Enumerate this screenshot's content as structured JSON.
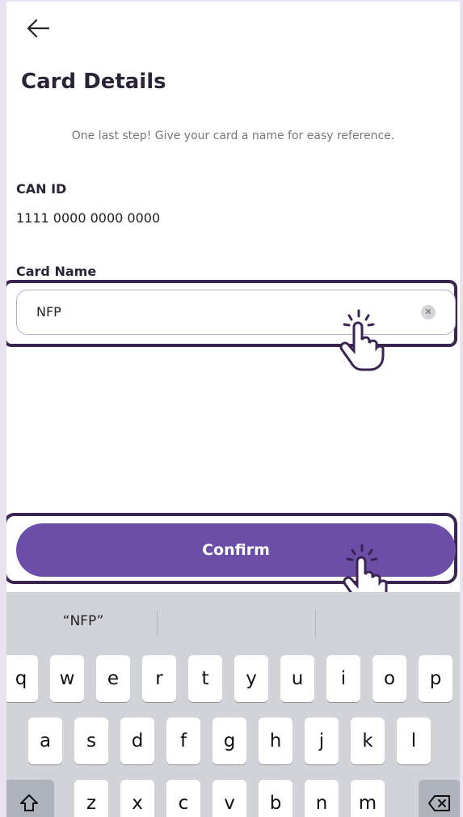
{
  "header": {
    "back_icon": "arrow-left-icon",
    "title": "Card Details"
  },
  "subtitle": "One last step! Give your card a name for easy reference.",
  "can": {
    "label": "CAN ID",
    "value": "1111 0000 0000 0000"
  },
  "card_name": {
    "label": "Card Name",
    "value": "NFP",
    "clear_icon": "clear-x-icon"
  },
  "confirm_label": "Confirm",
  "keyboard": {
    "suggestion": "“NFP”",
    "row1": [
      "q",
      "w",
      "e",
      "r",
      "t",
      "y",
      "u",
      "i",
      "o",
      "p"
    ],
    "row2": [
      "a",
      "s",
      "d",
      "f",
      "g",
      "h",
      "j",
      "k",
      "l"
    ],
    "row3": [
      "z",
      "x",
      "c",
      "v",
      "b",
      "n",
      "m"
    ],
    "shift_icon": "shift-icon",
    "backspace_icon": "backspace-icon"
  },
  "colors": {
    "accent": "#6a4ea8",
    "highlight": "#3b2454"
  }
}
